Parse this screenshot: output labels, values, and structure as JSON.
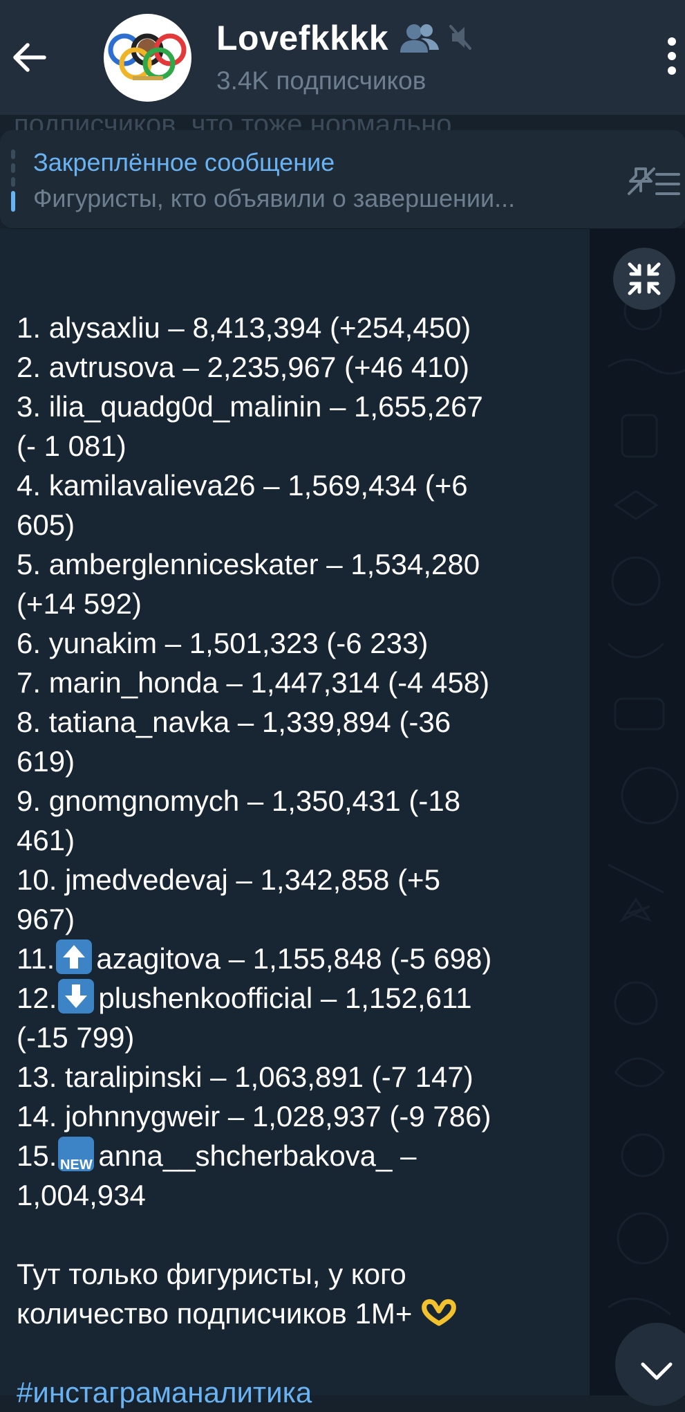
{
  "header": {
    "title": "Lovefkkkk",
    "subtitle": "3.4K подписчиков",
    "icons": [
      "arrow-left-icon",
      "group-icon",
      "mute-icon",
      "more-vertical-icon"
    ]
  },
  "behind_text": "подписчиков, что тоже нормально",
  "pinned": {
    "title": "Закреплённое сообщение",
    "text": "Фигуристы, кто объявили о завершении..."
  },
  "message": {
    "lines": [
      "",
      "1. alysaxliu – 8,413,394 (+254,450)",
      "2. avtrusova – 2,235,967 (+46 410)",
      "3. ilia_quadg0d_malinin – 1,655,267",
      "(- 1 081)",
      "4. kamilavalieva26 – 1,569,434 (+6",
      "605)",
      "5. amberglenniceskater – 1,534,280",
      "(+14 592)",
      "6. yunakim – 1,501,323 (-6 233)",
      "7. marin_honda – 1,447,314 (-4 458)",
      "8. tatiana_navka – 1,339,894 (-36",
      "619)",
      "9. gnomgnomych – 1,350,431 (-18",
      "461)",
      "10. jmedvedevaj – 1,342,858 (+5",
      "967)"
    ],
    "line11_prefix": "11.",
    "line11_text": "azagitova – 1,155,848 (-5 698)",
    "line12_prefix": "12.",
    "line12_text": "plushenkoofficial – 1,152,611",
    "line12b": "(-15 799)",
    "line13": "13. taralipinski – 1,063,891 (-7 147)",
    "line14": "14. johnnygweir – 1,028,937 (-9 786)",
    "line15_prefix": "15.",
    "new_badge": "NEW",
    "line15_text": "anna__shcherbakova_ –",
    "line15b": "1,004,934",
    "footer1": "Тут только фигуристы, у кого",
    "footer2": "количество подписчиков 1М+",
    "hashtag": "#инстаграманалитика"
  }
}
